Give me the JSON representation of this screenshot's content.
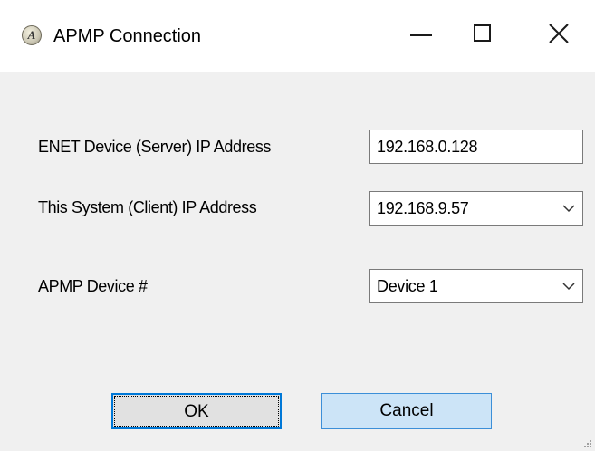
{
  "window": {
    "title": "APMP Connection",
    "icon_glyph": "A"
  },
  "fields": {
    "server_ip": {
      "label": "ENET Device (Server) IP Address",
      "value": "192.168.0.128"
    },
    "client_ip": {
      "label": "This System (Client) IP Address",
      "selected": "192.168.9.57"
    },
    "device": {
      "label": "APMP Device #",
      "selected": "Device 1"
    }
  },
  "buttons": {
    "ok": "OK",
    "cancel": "Cancel"
  },
  "colors": {
    "dialog_bg": "#f0f0f0",
    "focus_border": "#0078d7",
    "hover_bg": "#cce4f7"
  }
}
